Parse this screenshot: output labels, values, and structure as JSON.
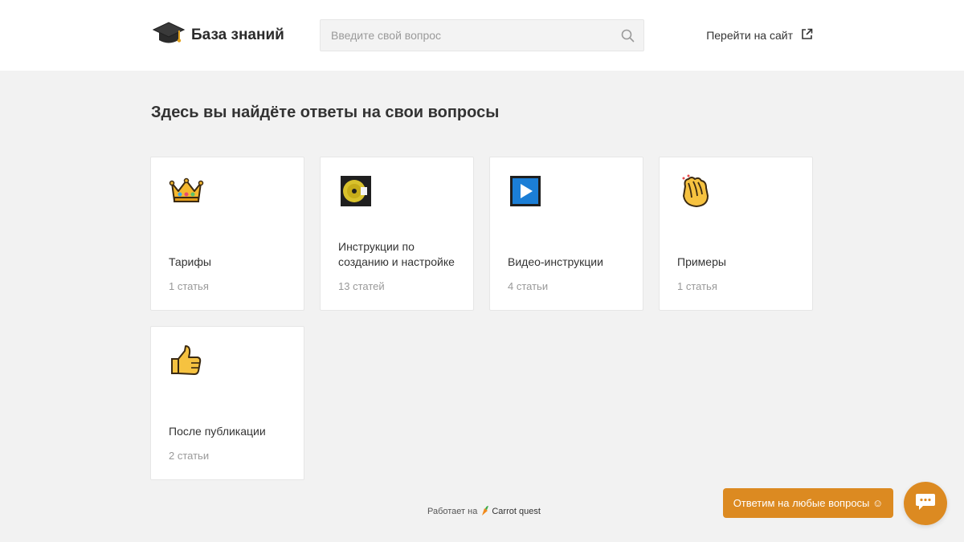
{
  "header": {
    "logo_icon": "graduation-cap-icon",
    "logo_title": "База знаний",
    "search_placeholder": "Введите свой вопрос",
    "search_icon": "search-icon",
    "site_link_label": "Перейти на сайт",
    "site_link_icon": "external-link-icon"
  },
  "main": {
    "title": "Здесь вы найдёте ответы на свои вопросы",
    "categories": [
      {
        "icon": "crown-icon",
        "title": "Тарифы",
        "count": "1 статья"
      },
      {
        "icon": "disc-icon",
        "title": "Инструкции по созданию и настройке",
        "count": "13 статей"
      },
      {
        "icon": "play-button-icon",
        "title": "Видео-инструкции",
        "count": "4 статьи"
      },
      {
        "icon": "clapping-hands-icon",
        "title": "Примеры",
        "count": "1 статья"
      },
      {
        "icon": "thumbs-up-icon",
        "title": "После публикации",
        "count": "2 статьи"
      }
    ]
  },
  "footer": {
    "powered_by": "Работает на",
    "brand": "Carrot quest",
    "brand_icon": "carrot-icon"
  },
  "chat": {
    "prompt_label": "Ответим на любые вопросы ☺",
    "button_icon": "chat-bubble-icon"
  },
  "colors": {
    "accent": "#dc8a21",
    "background": "#f2f2f2",
    "card_background": "#ffffff"
  }
}
